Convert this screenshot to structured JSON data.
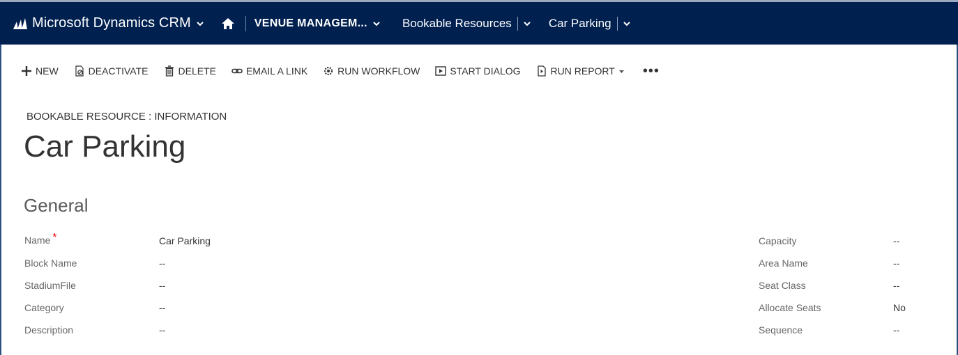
{
  "nav": {
    "app_title": "Microsoft Dynamics CRM",
    "area": "VENUE MANAGEM...",
    "entity": "Bookable Resources",
    "record": "Car Parking",
    "colors": {
      "navbar": "#002050",
      "accent": "#e00000"
    }
  },
  "commands": {
    "new": "NEW",
    "deactivate": "DEACTIVATE",
    "delete": "DELETE",
    "email_link": "EMAIL A LINK",
    "run_workflow": "RUN WORKFLOW",
    "start_dialog": "START DIALOG",
    "run_report": "RUN REPORT",
    "more": "•••"
  },
  "header": {
    "entity_form": "BOOKABLE RESOURCE : INFORMATION",
    "title": "Car Parking"
  },
  "section": {
    "title": "General",
    "required_marker": "*",
    "left_fields": [
      {
        "label": "Name",
        "value": "Car Parking"
      },
      {
        "label": "Block Name",
        "value": "--"
      },
      {
        "label": "StadiumFile",
        "value": "--"
      },
      {
        "label": "Category",
        "value": "--"
      },
      {
        "label": "Description",
        "value": "--"
      }
    ],
    "right_fields": [
      {
        "label": "Capacity",
        "value": "--"
      },
      {
        "label": "Area Name",
        "value": "--"
      },
      {
        "label": "Seat Class",
        "value": "--"
      },
      {
        "label": "Allocate Seats",
        "value": "No"
      },
      {
        "label": "Sequence",
        "value": "--"
      }
    ]
  }
}
